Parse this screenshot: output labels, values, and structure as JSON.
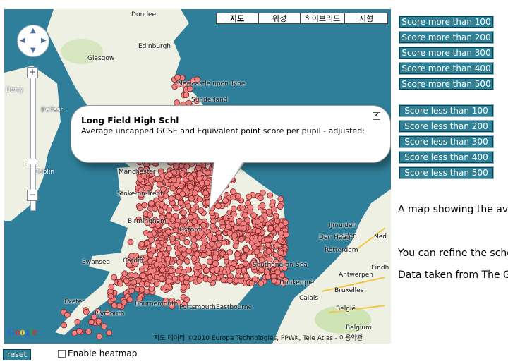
{
  "map": {
    "type_buttons": [
      "지도",
      "위성",
      "하이브리드",
      "지형"
    ],
    "active_type": 0,
    "copyright": "지도 데이터 ©2010 Europa Technologies, PPWK, Tele Atlas - 이용약관",
    "google_logo": "Google",
    "cities": [
      {
        "name": "Dundee",
        "light": false
      },
      {
        "name": "Edinburgh",
        "light": false
      },
      {
        "name": "Glasgow",
        "light": false
      },
      {
        "name": "Derry",
        "light": true
      },
      {
        "name": "Belfast",
        "light": true
      },
      {
        "name": "Newcastle upon Tyne",
        "light": false
      },
      {
        "name": "Sunderland",
        "light": false
      },
      {
        "name": "Dublin",
        "light": true
      },
      {
        "name": "Manchester",
        "light": false
      },
      {
        "name": "Stoke-on-Trent",
        "light": false
      },
      {
        "name": "Birmingham",
        "light": false
      },
      {
        "name": "Oxford",
        "light": false
      },
      {
        "name": "Swansea",
        "light": false
      },
      {
        "name": "Cardiff",
        "light": false
      },
      {
        "name": "Exeter",
        "light": false
      },
      {
        "name": "Bournemouth",
        "light": false
      },
      {
        "name": "Portsmouth",
        "light": false
      },
      {
        "name": "Eastbourne",
        "light": false
      },
      {
        "name": "Plymouth",
        "light": false
      },
      {
        "name": "Southend-on-Sea",
        "light": false
      },
      {
        "name": "Dunkerque",
        "light": false
      },
      {
        "name": "Calais",
        "light": false
      },
      {
        "name": "Bruxelles",
        "light": false
      },
      {
        "name": "België",
        "light": false
      },
      {
        "name": "Belgium",
        "light": false
      },
      {
        "name": "Rotterdam",
        "light": false
      },
      {
        "name": "Leiden",
        "light": false
      },
      {
        "name": "IJmuiden",
        "light": false
      },
      {
        "name": "Ned",
        "light": false
      },
      {
        "name": "Den Haag",
        "light": false
      },
      {
        "name": "Eindh",
        "light": false
      },
      {
        "name": "Antwerpen",
        "light": false
      }
    ],
    "popup": {
      "title": "Long Field High Schl",
      "body": "Average uncapped GCSE and Equivalent point score per pupil - adjusted:"
    }
  },
  "more_than": [
    "Score more than 100",
    "Score more than 200",
    "Score more than 300",
    "Score more than 400",
    "Score more than 500"
  ],
  "less_than": [
    "Score less than 100",
    "Score less than 200",
    "Score less than 300",
    "Score less than 400",
    "Score less than 500"
  ],
  "description": "A map showing the aver",
  "refine": "You can refine the scho",
  "data_source": {
    "prefix": "Data taken from ",
    "link": "The Gu"
  },
  "controls": {
    "reset_label": "reset",
    "heatmap_label": "Enable heatmap",
    "heatmap_enabled": false
  },
  "colors": {
    "sea": "#2f7f9a",
    "land": "#eef0e4",
    "marker": "#f08080",
    "button": "#2e8196"
  }
}
